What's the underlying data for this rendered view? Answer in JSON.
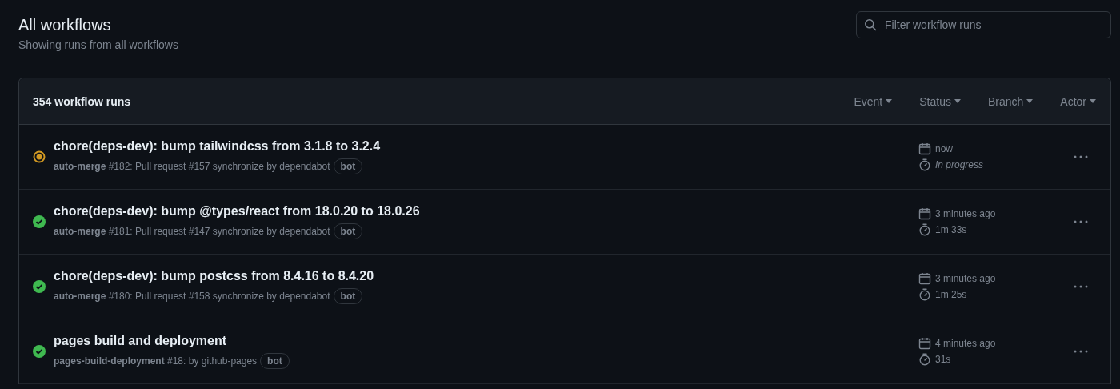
{
  "header": {
    "title": "All workflows",
    "subtitle": "Showing runs from all workflows"
  },
  "search": {
    "placeholder": "Filter workflow runs"
  },
  "runs_panel": {
    "count": "354 workflow runs",
    "filters": [
      "Event",
      "Status",
      "Branch",
      "Actor"
    ],
    "runs": [
      {
        "kind": "in_progress",
        "title": "chore(deps-dev): bump tailwindcss from 3.1.8 to 3.2.4",
        "meta": "**auto-merge** #182: Pull request #157 synchronize by dependabot",
        "badge": "bot",
        "started": "now",
        "duration": "In progress"
      },
      {
        "kind": "success",
        "title": "chore(deps-dev): bump @types/react from 18.0.20 to 18.0.26",
        "meta": "**auto-merge** #181: Pull request #147 synchronize by dependabot",
        "badge": "bot",
        "started": "3 minutes ago",
        "duration": "1m 33s"
      },
      {
        "kind": "success",
        "title": "chore(deps-dev): bump postcss from 8.4.16 to 8.4.20",
        "meta": "**auto-merge** #180: Pull request #158 synchronize by dependabot",
        "badge": "bot",
        "started": "3 minutes ago",
        "duration": "1m 25s"
      },
      {
        "kind": "success",
        "title": "pages build and deployment",
        "meta": "**pages-build-deployment** #18: by github-pages",
        "badge": "bot",
        "started": "4 minutes ago",
        "duration": "31s"
      }
    ]
  }
}
